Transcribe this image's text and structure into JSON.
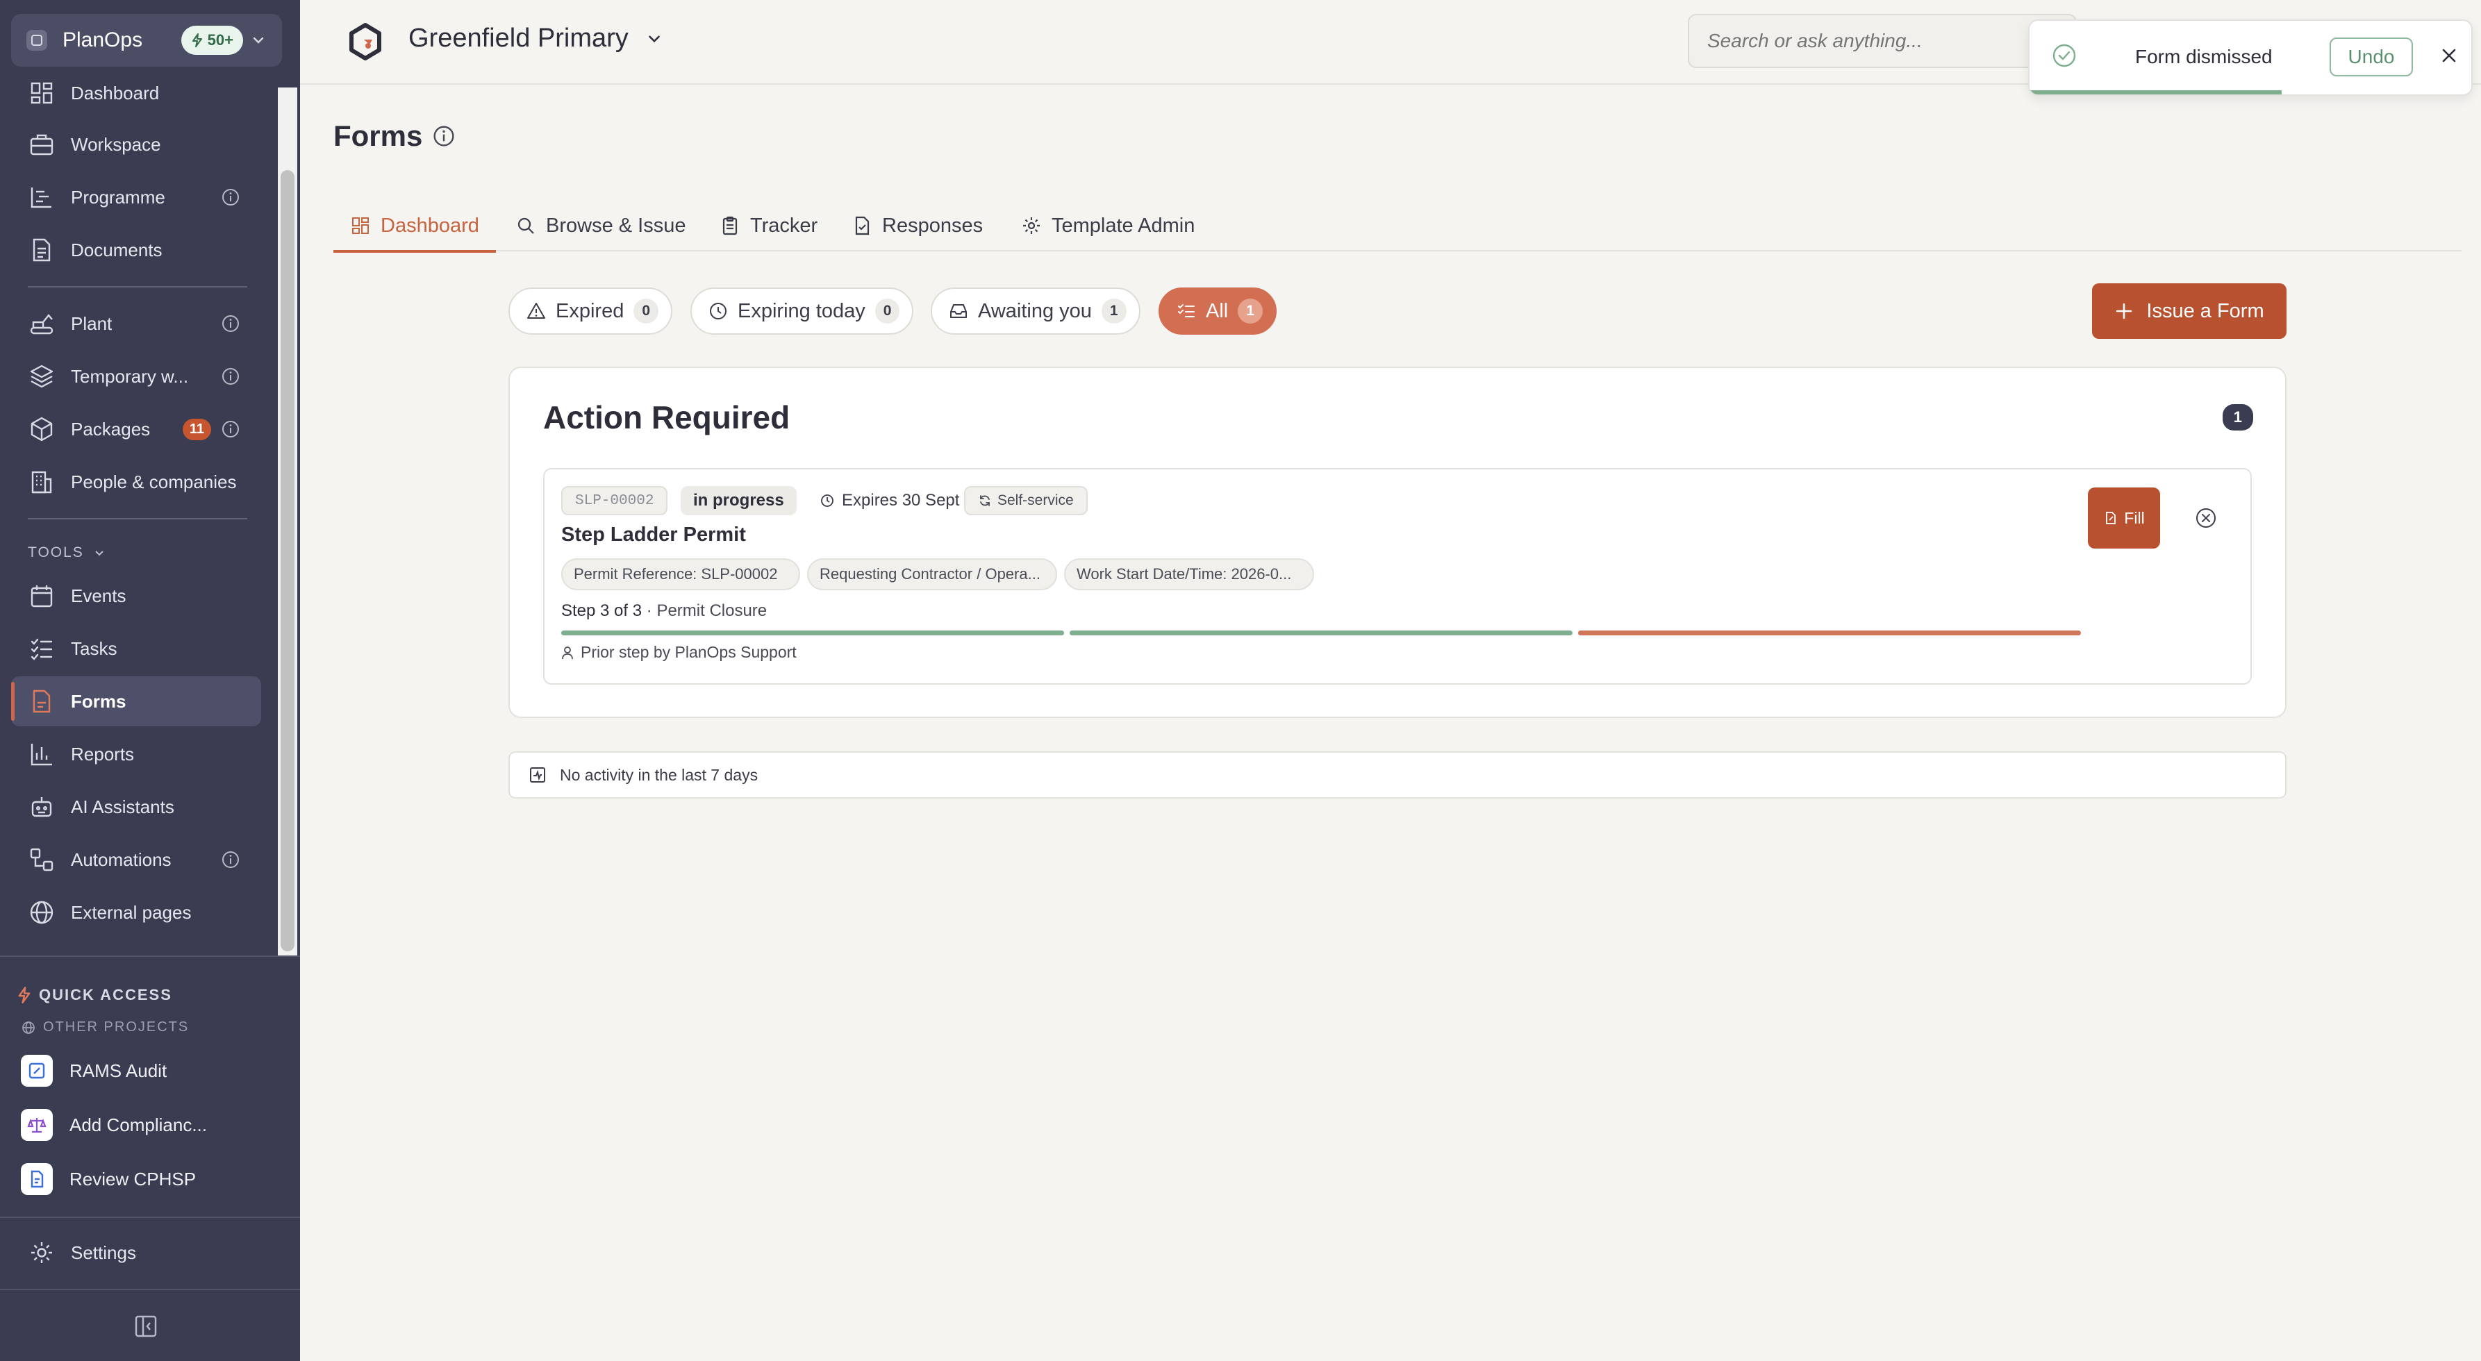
{
  "org": {
    "name": "PlanOps",
    "badge": "50+"
  },
  "sidebar": {
    "items": [
      {
        "label": "Dashboard"
      },
      {
        "label": "Workspace"
      },
      {
        "label": "Programme"
      },
      {
        "label": "Documents"
      },
      {
        "label": "Plant"
      },
      {
        "label": "Temporary w..."
      },
      {
        "label": "Packages",
        "count": "11"
      },
      {
        "label": "People & companies"
      }
    ],
    "tools_label": "TOOLS",
    "tools": [
      {
        "label": "Events"
      },
      {
        "label": "Tasks"
      },
      {
        "label": "Forms"
      },
      {
        "label": "Reports"
      },
      {
        "label": "AI Assistants"
      },
      {
        "label": "Automations"
      },
      {
        "label": "External pages"
      }
    ],
    "quick_access": "QUICK ACCESS",
    "other_projects": "OTHER PROJECTS",
    "projects": [
      {
        "label": "RAMS Audit",
        "color": "#3b6fd8"
      },
      {
        "label": "Add Complianc...",
        "color": "#8a4fd0"
      },
      {
        "label": "Review CPHSP",
        "color": "#3b6fd8"
      }
    ],
    "settings": "Settings"
  },
  "header": {
    "project": "Greenfield Primary",
    "search_placeholder": "Search or ask anything..."
  },
  "toast": {
    "message": "Form dismissed",
    "undo": "Undo",
    "progress": 0.57
  },
  "page": {
    "title": "Forms"
  },
  "tabs": [
    {
      "label": "Dashboard",
      "icon": "dashboard-icon"
    },
    {
      "label": "Browse & Issue",
      "icon": "search-icon"
    },
    {
      "label": "Tracker",
      "icon": "clipboard-icon"
    },
    {
      "label": "Responses",
      "icon": "document-icon"
    },
    {
      "label": "Template Admin",
      "icon": "gear-icon"
    }
  ],
  "filters": [
    {
      "label": "Expired",
      "count": "0",
      "icon": "warning-icon"
    },
    {
      "label": "Expiring today",
      "count": "0",
      "icon": "clock-icon"
    },
    {
      "label": "Awaiting you",
      "count": "1",
      "icon": "inbox-icon"
    },
    {
      "label": "All",
      "count": "1",
      "icon": "list-icon"
    }
  ],
  "issue_button": "Issue a Form",
  "action_required": {
    "title": "Action Required",
    "count": "1",
    "card": {
      "code": "SLP-00002",
      "status": "in progress",
      "expires": "Expires 30 Sept",
      "mode": "Self-service",
      "title": "Step Ladder Permit",
      "tags": [
        "Permit Reference: SLP-00002",
        "Requesting Contractor / Opera...",
        "Work Start Date/Time: 2026-0..."
      ],
      "step": "Step 3 of 3",
      "step_name": "Permit Closure",
      "prior": "Prior step by PlanOps Support",
      "fill": "Fill",
      "progress_colors": [
        "#7fae8f",
        "#7fae8f",
        "#d0765a"
      ]
    }
  },
  "activity": "No activity in the last 7 days",
  "colors": {
    "accent": "#c7643f",
    "sidebar": "#3a3c52",
    "success": "#7fae8f"
  }
}
